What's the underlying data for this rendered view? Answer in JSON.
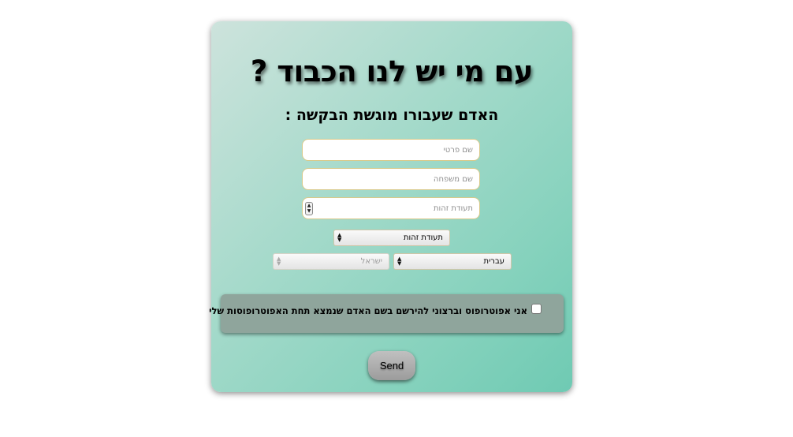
{
  "form": {
    "title": "עם מי יש לנו הכבוד ?",
    "subtitle": "האדם שעבורו מוגשת הבקשה :",
    "first_name_placeholder": "שם פרטי",
    "last_name_placeholder": "שם משפחה",
    "id_number_placeholder": "תעודת זהות",
    "document_type": {
      "selected": "תעודת זהות"
    },
    "language": {
      "selected": "עברית"
    },
    "country": {
      "selected": "ישראל",
      "disabled": true
    },
    "guardian_consent": {
      "checked": false,
      "label": "אני אפוטרופוס וברצוני להירשם בשם האדם שנמצא תחת האפוטרופוסות שלי"
    },
    "send_label": "Send"
  },
  "colors": {
    "card_gradient_start": "#cde3dc",
    "card_gradient_end": "#6fcab3",
    "notice_background": "#8fa59c",
    "button_background": "#a9a9a9",
    "field_border": "#d8c98a"
  }
}
